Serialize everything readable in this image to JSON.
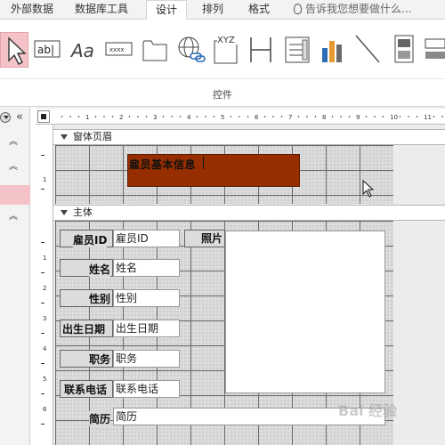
{
  "ribbon": {
    "tabs": [
      "外部数据",
      "数据库工具",
      "设计",
      "排列",
      "格式"
    ],
    "active_tab": "设计",
    "tell_me": "告诉我您想要做什么...",
    "controls": [
      {
        "name": "select-pointer-icon"
      },
      {
        "name": "textbox-icon",
        "glyph": "ab|"
      },
      {
        "name": "label-icon",
        "glyph": "Aa"
      },
      {
        "name": "button-icon",
        "glyph": "xxxx"
      },
      {
        "name": "tab-control-icon"
      },
      {
        "name": "hyperlink-icon"
      },
      {
        "name": "web-browser-icon",
        "glyph": "XYZ"
      },
      {
        "name": "navigation-icon"
      },
      {
        "name": "option-group-icon"
      },
      {
        "name": "chart-icon"
      },
      {
        "name": "line-icon"
      },
      {
        "name": "toggle-icon"
      },
      {
        "name": "rectangle-icon"
      }
    ],
    "group_label": "控件"
  },
  "sections": {
    "form_header": "窗体页眉",
    "detail": "主体"
  },
  "ruler_numbers": [
    "1",
    "2",
    "3",
    "4",
    "5",
    "6",
    "7",
    "8",
    "9",
    "10",
    "11"
  ],
  "left_ruler_numbers": [
    "1",
    "1",
    "2",
    "3",
    "4",
    "5",
    "6"
  ],
  "form": {
    "title": "雇员基本信息",
    "fields": [
      {
        "label": "雇员ID",
        "value": "雇员ID"
      },
      {
        "label": "姓名",
        "value": "姓名"
      },
      {
        "label": "性别",
        "value": "性别"
      },
      {
        "label": "出生日期",
        "value": "出生日期"
      },
      {
        "label": "职务",
        "value": "职务"
      },
      {
        "label": "联系电话",
        "value": "联系电话"
      },
      {
        "label": "简历",
        "value": "简历"
      }
    ],
    "photo_label": "照片"
  },
  "watermark": "Bai 经验",
  "colors": {
    "accent_selected": "#f4c3c8",
    "title_fill": "#962e00",
    "grid_line": "#6a6a6a"
  }
}
